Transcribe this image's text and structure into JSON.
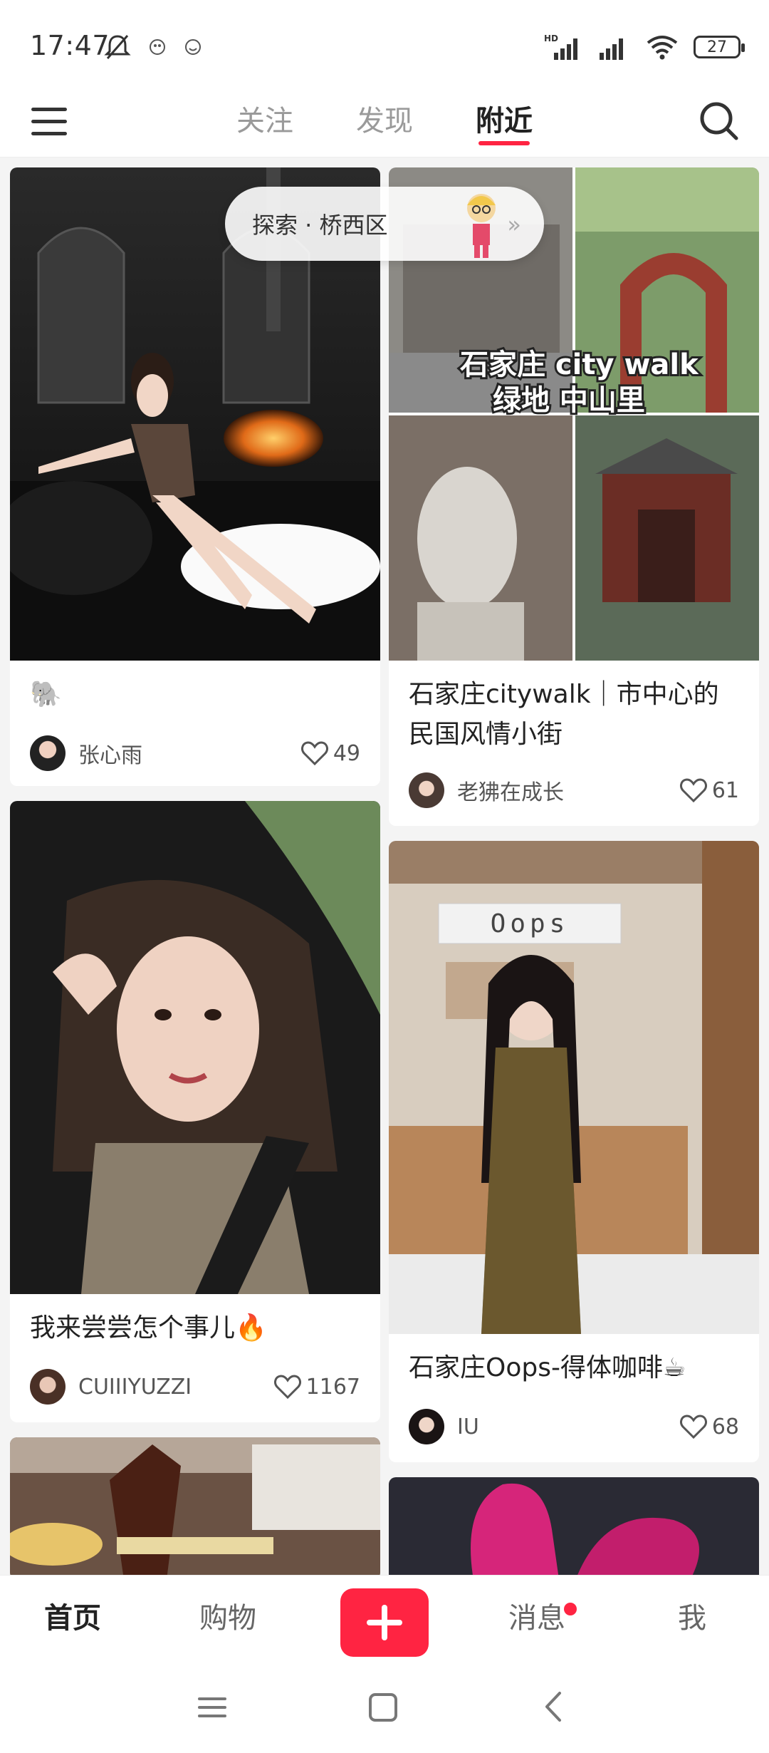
{
  "status_bar": {
    "time": "17:47",
    "battery": "27",
    "network_label": "HD",
    "icons": [
      "bell-off-icon",
      "app-notify-icon",
      "app-notify-icon-2",
      "hd-signal-icon",
      "signal-icon",
      "wifi-icon",
      "battery-icon"
    ]
  },
  "top_nav": {
    "tabs": [
      {
        "label": "关注",
        "active": false
      },
      {
        "label": "发现",
        "active": false
      },
      {
        "label": "附近",
        "active": true
      }
    ],
    "accent_color": "#ff2442"
  },
  "explore_pill": {
    "label": "探索 · 桥西区",
    "arrow": "»"
  },
  "feed": {
    "cards": [
      {
        "title": "🐘",
        "author": "张心雨",
        "likes": "49"
      },
      {
        "title": "石家庄citywalk｜市中心的民国风情小街",
        "image_caption_1": "石家庄 city walk",
        "image_caption_2": "绿地 中山里",
        "author": "老狒在成长",
        "likes": "61"
      },
      {
        "title": "我来尝尝怎个事儿🔥",
        "author": "CUIIIYUZZI",
        "likes": "1167"
      },
      {
        "title": "石家庄Oops-得体咖啡☕",
        "image_sign": "Oops",
        "author": "IU",
        "likes": "68"
      }
    ]
  },
  "bottom_bar": {
    "tabs": [
      {
        "label": "首页",
        "active": true
      },
      {
        "label": "购物",
        "active": false
      },
      {
        "label": "消息",
        "active": false,
        "has_dot": true
      },
      {
        "label": "我",
        "active": false
      }
    ]
  }
}
